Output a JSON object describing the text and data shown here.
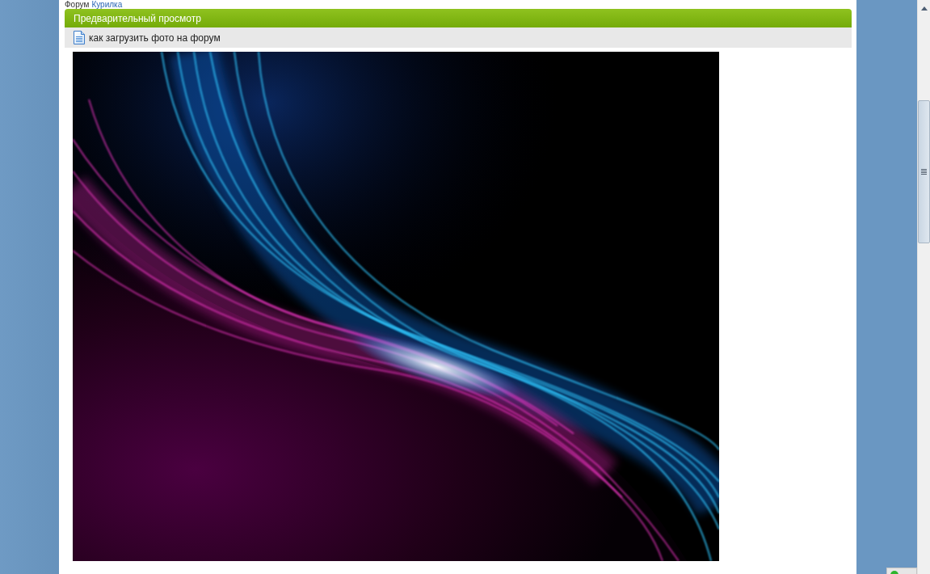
{
  "breadcrumb": [
    {
      "label": "Форум",
      "kind": "text"
    },
    {
      "label": "Курилка",
      "kind": "link"
    }
  ],
  "preview": {
    "title": "Предварительный просмотр",
    "topic": "как загрузить фото на форум"
  }
}
